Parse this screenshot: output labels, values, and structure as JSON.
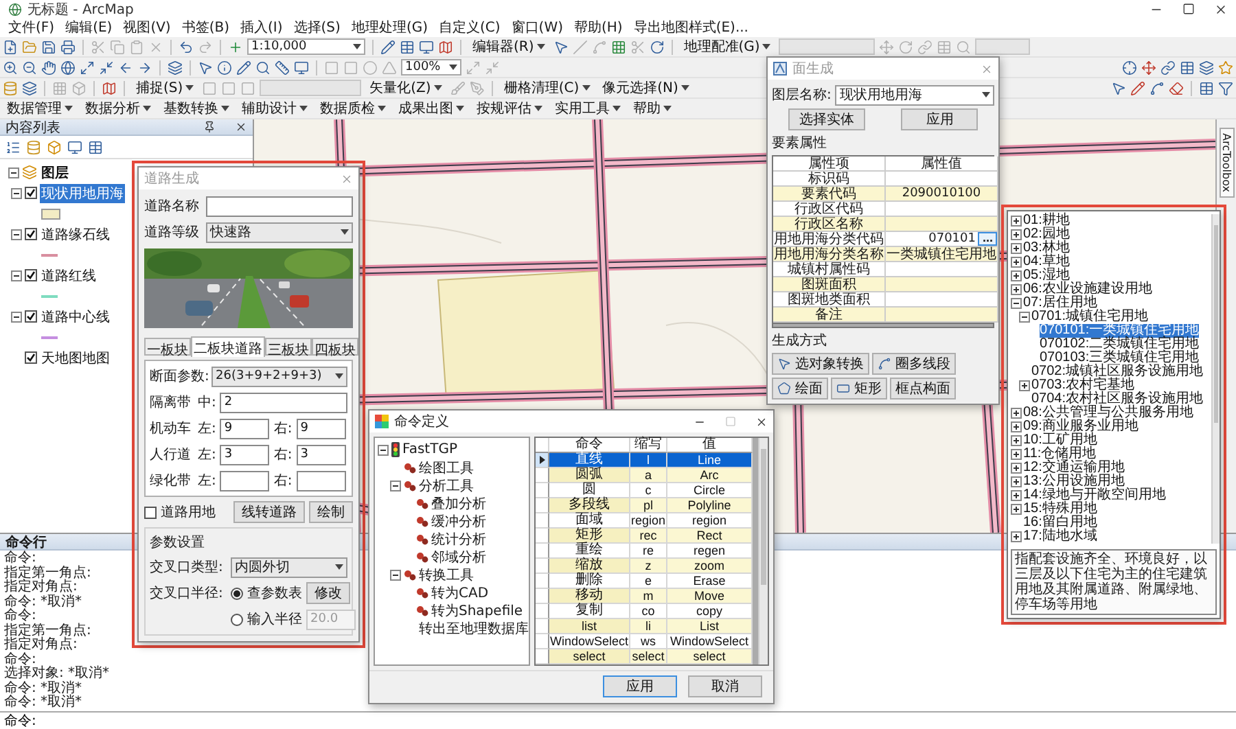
{
  "window": {
    "title": "无标题 - ArcMap"
  },
  "menu": [
    "文件(F)",
    "编辑(E)",
    "视图(V)",
    "书签(B)",
    "插入(I)",
    "选择(S)",
    "地理处理(G)",
    "自定义(C)",
    "窗口(W)",
    "帮助(H)",
    "导出地图样式(E)..."
  ],
  "toolbar": {
    "scale": "1:10,000",
    "editor": "编辑器(R)",
    "georeference": "地理配准(G)",
    "zoom": "100%",
    "snapping": "捕捉(S)",
    "vectorization": "矢量化(Z)",
    "raster_cleanup": "栅格清理(C)",
    "cell_selection": "像元选择(N)"
  },
  "custom_menus": [
    "数据管理",
    "数据分析",
    "基数转换",
    "辅助设计",
    "数据质检",
    "成果出图",
    "按规评估",
    "实用工具",
    "帮助"
  ],
  "toc": {
    "title": "内容列表",
    "root": {
      "label": "图层",
      "expanded": true
    },
    "layers": [
      {
        "name": "现状用地用海",
        "checked": true,
        "selected": true,
        "expanded": true,
        "kind": "fill",
        "color": "#f3ecc4"
      },
      {
        "name": "道路缘石线",
        "checked": true,
        "selected": false,
        "expanded": true,
        "kind": "line",
        "color": "#d98fa0"
      },
      {
        "name": "道路红线",
        "checked": true,
        "selected": false,
        "expanded": true,
        "kind": "line",
        "color": "#7fdcc0"
      },
      {
        "name": "道路中心线",
        "checked": true,
        "selected": false,
        "expanded": true,
        "kind": "line",
        "color": "#c58ee0"
      },
      {
        "name": "天地图地图",
        "checked": true,
        "selected": false,
        "kind": "raster"
      }
    ]
  },
  "side_tabs": [
    "ArcToolbox"
  ],
  "command_window": {
    "title": "命令行",
    "lines": [
      "命令:",
      "指定第一角点:",
      "指定对角点:",
      "命令: *取消*",
      "命令:",
      "指定第一角点:",
      "指定对角点:",
      "命令:",
      "选择对象: *取消*",
      "命令: *取消*",
      "命令: *取消*"
    ],
    "prompt": "命令:"
  },
  "road_dialog": {
    "title": "道路生成",
    "fields": [
      {
        "label": "道路名称",
        "kind": "input"
      },
      {
        "label": "道路等级",
        "kind": "select",
        "value": "快速路"
      }
    ],
    "tabs": [
      {
        "label": "一板块",
        "selected": false
      },
      {
        "label": "二板块道路",
        "selected": true
      },
      {
        "label": "三板块",
        "selected": false
      },
      {
        "label": "四板块",
        "selected": false
      }
    ],
    "section": {
      "label": "断面参数:",
      "value": "26(3+9+2+9+3)"
    },
    "widths": [
      {
        "label": "隔离带",
        "parts": [
          {
            "side": "中:",
            "value": "2"
          }
        ]
      },
      {
        "label": "机动车",
        "parts": [
          {
            "side": "左:",
            "value": "9"
          },
          {
            "side": "右:",
            "value": "9"
          }
        ]
      },
      {
        "label": "人行道",
        "parts": [
          {
            "side": "左:",
            "value": "3"
          },
          {
            "side": "右:",
            "value": "3"
          }
        ]
      },
      {
        "label": "绿化带",
        "parts": [
          {
            "side": "左:"
          },
          {
            "side": "右:"
          }
        ]
      }
    ],
    "land": {
      "label": "道路用地",
      "checked": false
    },
    "actions": [
      "线转道路",
      "绘制"
    ],
    "params": {
      "title": "参数设置",
      "cross_label": "交叉口类型:",
      "cross_type": "内圆外切",
      "radius_label": "交叉口半径:",
      "options": [
        {
          "label": "查参数表",
          "selected": true
        },
        {
          "label": "输入半径",
          "selected": false
        }
      ],
      "modify": "修改",
      "radius": {
        "value": "20.0",
        "disabled": true
      }
    }
  },
  "command_dialog": {
    "title": "命令定义",
    "tree": {
      "label": "FastTGP",
      "expanded": true,
      "children": [
        {
          "label": "绘图工具"
        },
        {
          "label": "分析工具",
          "expanded": true,
          "children": [
            {
              "label": "叠加分析"
            },
            {
              "label": "缓冲分析"
            },
            {
              "label": "统计分析"
            },
            {
              "label": "邻域分析"
            }
          ]
        },
        {
          "label": "转换工具",
          "expanded": true,
          "children": [
            {
              "label": "转为CAD"
            },
            {
              "label": "转为Shapefile"
            },
            {
              "label": "转出至地理数据库"
            }
          ]
        }
      ]
    },
    "columns": [
      "命令",
      "缩写",
      "值"
    ],
    "rows": [
      {
        "cells": [
          "直线",
          "l",
          "Line"
        ],
        "selected": true
      },
      {
        "cells": [
          "圆弧",
          "a",
          "Arc"
        ],
        "selected": false
      },
      {
        "cells": [
          "圆",
          "c",
          "Circle"
        ],
        "selected": false
      },
      {
        "cells": [
          "多段线",
          "pl",
          "Polyline"
        ],
        "selected": false
      },
      {
        "cells": [
          "面域",
          "region",
          "region"
        ],
        "selected": false
      },
      {
        "cells": [
          "矩形",
          "rec",
          "Rect"
        ],
        "selected": false
      },
      {
        "cells": [
          "重绘",
          "re",
          "regen"
        ],
        "selected": false
      },
      {
        "cells": [
          "缩放",
          "z",
          "zoom"
        ],
        "selected": false
      },
      {
        "cells": [
          "删除",
          "e",
          "Erase"
        ],
        "selected": false
      },
      {
        "cells": [
          "移动",
          "m",
          "Move"
        ],
        "selected": false
      },
      {
        "cells": [
          "复制",
          "co",
          "copy"
        ],
        "selected": false
      },
      {
        "cells": [
          "list",
          "li",
          "List"
        ],
        "selected": false
      },
      {
        "cells": [
          "WindowSelect",
          "ws",
          "WindowSelect"
        ],
        "selected": false
      },
      {
        "cells": [
          "select",
          "select",
          "select"
        ],
        "selected": false
      }
    ],
    "buttons": [
      "应用",
      "取消"
    ]
  },
  "feature_dialog": {
    "title": "面生成",
    "layer_label": "图层名称:",
    "layer": "现状用地用海",
    "buttons": [
      "选择实体",
      "应用"
    ],
    "group": "要素属性",
    "columns": [
      "属性项",
      "属性值"
    ],
    "rows": [
      {
        "name": "标识码"
      },
      {
        "name": "要素代码",
        "value": "2090010100"
      },
      {
        "name": "行政区代码"
      },
      {
        "name": "行政区名称"
      },
      {
        "name": "用地用海分类代码",
        "value": "070101",
        "button": "..."
      },
      {
        "name": "用地用海分类名称",
        "value": "一类城镇住宅用地"
      },
      {
        "name": "城镇村属性码"
      },
      {
        "name": "图斑面积"
      },
      {
        "name": "图斑地类面积"
      },
      {
        "name": "备注"
      }
    ],
    "method_label": "生成方式",
    "methods": [
      {
        "label": "选对象转换",
        "kind": "pointer"
      },
      {
        "label": "圈多线段",
        "kind": "polyline"
      },
      {
        "label": "绘面",
        "kind": "polygon"
      },
      {
        "label": "矩形",
        "kind": "rect"
      },
      {
        "label": "框点构面",
        "kind": "plain"
      }
    ]
  },
  "class_tree": {
    "items": [
      {
        "label": "01:耕地",
        "expanded": false,
        "selected": false
      },
      {
        "label": "02:园地",
        "expanded": false,
        "selected": false
      },
      {
        "label": "03:林地",
        "expanded": false,
        "selected": false
      },
      {
        "label": "04:草地",
        "expanded": false,
        "selected": false
      },
      {
        "label": "05:湿地",
        "expanded": false,
        "selected": false
      },
      {
        "label": "06:农业设施建设用地",
        "expanded": false,
        "selected": false
      },
      {
        "label": "07:居住用地",
        "expanded": true,
        "selected": false,
        "children": [
          {
            "label": "0701:城镇住宅用地",
            "expanded": true,
            "selected": false,
            "children": [
              {
                "label": "070101:一类城镇住宅用地",
                "selected": true
              },
              {
                "label": "070102:二类城镇住宅用地",
                "selected": false
              },
              {
                "label": "070103:三类城镇住宅用地",
                "selected": false
              }
            ]
          },
          {
            "label": "0702:城镇社区服务设施用地",
            "selected": false
          },
          {
            "label": "0703:农村宅基地",
            "expanded": false,
            "selected": false
          },
          {
            "label": "0704:农村社区服务设施用地",
            "selected": false
          }
        ]
      },
      {
        "label": "08:公共管理与公共服务用地",
        "expanded": false,
        "selected": false
      },
      {
        "label": "09:商业服务业用地",
        "expanded": false,
        "selected": false
      },
      {
        "label": "10:工矿用地",
        "expanded": false,
        "selected": false
      },
      {
        "label": "11:仓储用地",
        "expanded": false,
        "selected": false
      },
      {
        "label": "12:交通运输用地",
        "expanded": false,
        "selected": false
      },
      {
        "label": "13:公用设施用地",
        "expanded": false,
        "selected": false
      },
      {
        "label": "14:绿地与开敞空间用地",
        "expanded": false,
        "selected": false
      },
      {
        "label": "15:特殊用地",
        "expanded": false,
        "selected": false
      },
      {
        "label": "16:留白用地",
        "selected": false
      },
      {
        "label": "17:陆地水域",
        "expanded": false,
        "selected": false
      }
    ],
    "description": "指配套设施齐全、环境良好，以三层及以下住宅为主的住宅建筑用地及其附属道路、附属绿地、停车场等用地"
  }
}
